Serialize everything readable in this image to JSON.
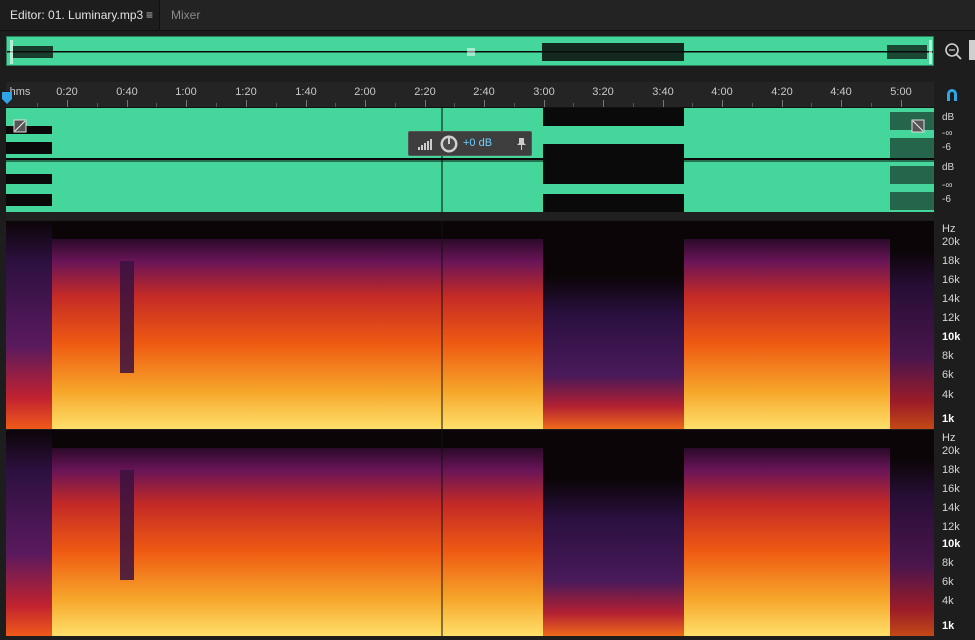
{
  "tabs": {
    "editor": "Editor: 01. Luminary.mp3",
    "editor_menu": "≡",
    "mixer": "Mixer"
  },
  "ruler": {
    "unit": "hms",
    "labels": [
      "0:20",
      "0:40",
      "1:00",
      "1:20",
      "1:40",
      "2:00",
      "2:20",
      "2:40",
      "3:00",
      "3:20",
      "3:40",
      "4:00",
      "4:20",
      "4:40",
      "5:00"
    ]
  },
  "hud": {
    "volume": "+0 dB"
  },
  "db_scale": {
    "ch1": [
      "dB",
      "-∞",
      "-6"
    ],
    "ch2": [
      "dB",
      "-∞",
      "-6"
    ]
  },
  "hz_scale": {
    "ch1": [
      "Hz",
      "20k",
      "18k",
      "16k",
      "14k",
      "12k",
      "10k",
      "8k",
      "6k",
      "4k",
      "1k"
    ],
    "ch2": [
      "Hz",
      "20k",
      "18k",
      "16k",
      "14k",
      "12k",
      "10k",
      "8k",
      "6k",
      "4k",
      "1k"
    ]
  },
  "colors": {
    "waveform_bg": "#45d69b",
    "waveform_fg": "#0a0a0a",
    "accent": "#2fa4e7"
  },
  "icons": {
    "panel_menu": "hamburger-icon",
    "zoom": "zoom-selection-icon",
    "snap": "snap-magnet-icon",
    "hud_meter": "level-meter-icon",
    "hud_knob": "volume-knob-icon",
    "hud_pin": "pin-icon"
  }
}
